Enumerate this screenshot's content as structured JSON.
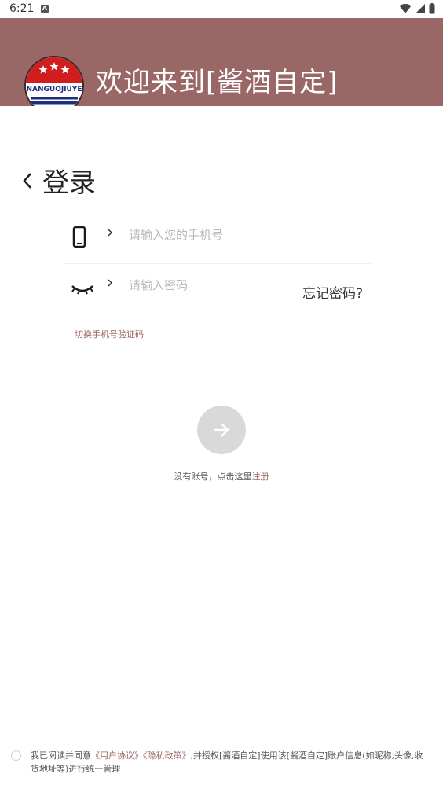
{
  "status_bar": {
    "time": "6:21",
    "notification_glyph": "A",
    "icons": [
      "wifi-icon",
      "signal-icon",
      "battery-icon"
    ]
  },
  "header": {
    "welcome": "欢迎来到[酱酒自定]",
    "logo_text": "NANGUOJIUYE"
  },
  "login": {
    "title": "登录"
  },
  "phone_field": {
    "placeholder": "请输入您的手机号",
    "value": ""
  },
  "password_field": {
    "placeholder": "请输入密码",
    "value": "",
    "forgot_label": "忘记密码?"
  },
  "switch_mode_label": "切换手机号验证码",
  "register": {
    "prefix": "没有账号，点击这里",
    "link": "注册"
  },
  "agreement": {
    "prefix": "我已阅读并同意",
    "user_agreement": "《用户协议》",
    "privacy_policy": "《隐私政策》",
    "suffix": ",并授权[酱酒自定]使用该[酱酒自定]账户信息(如昵称,头像,收货地址等)进行统一管理",
    "checked": false
  },
  "colors": {
    "brand": "#9a6767",
    "submit_disabled": "#d9d9d9"
  }
}
